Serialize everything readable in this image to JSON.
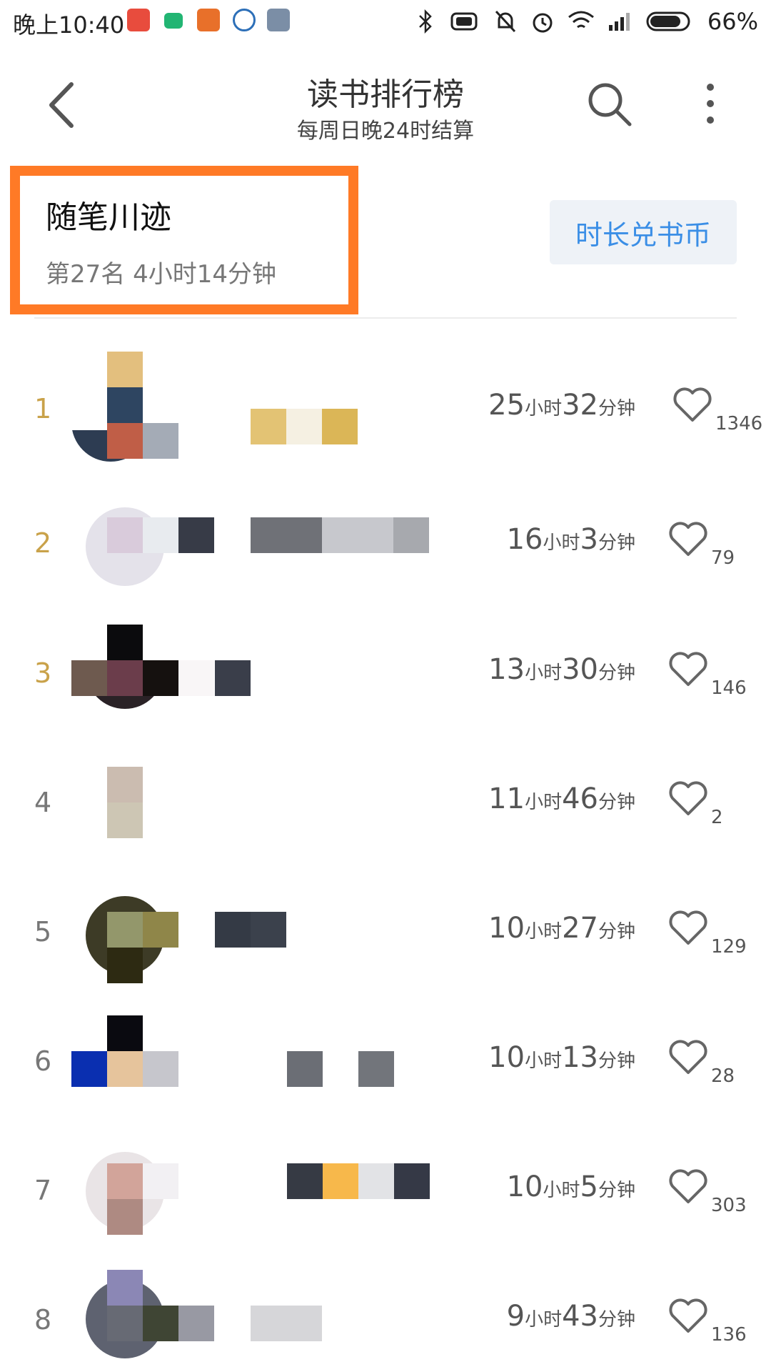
{
  "status_bar": {
    "time": "晚上10:40",
    "battery": "66%"
  },
  "header": {
    "title": "读书排行榜",
    "subtitle": "每周日晚24时结算"
  },
  "my_rank": {
    "name": "随笔川迹",
    "rank_text": "第27名 4小时14分钟"
  },
  "exchange_button": "时长兑书币",
  "units": {
    "hour": "小时",
    "minute": "分钟"
  },
  "rows": [
    {
      "rank": "1",
      "hours": "25",
      "minutes": "32",
      "likes": "1346"
    },
    {
      "rank": "2",
      "hours": "16",
      "minutes": "3",
      "likes": "79"
    },
    {
      "rank": "3",
      "hours": "13",
      "minutes": "30",
      "likes": "146"
    },
    {
      "rank": "4",
      "hours": "11",
      "minutes": "46",
      "likes": "2"
    },
    {
      "rank": "5",
      "hours": "10",
      "minutes": "27",
      "likes": "129"
    },
    {
      "rank": "6",
      "hours": "10",
      "minutes": "13",
      "likes": "28"
    },
    {
      "rank": "7",
      "hours": "10",
      "minutes": "5",
      "likes": "303"
    },
    {
      "rank": "8",
      "hours": "9",
      "minutes": "43",
      "likes": "136"
    }
  ],
  "icons": {
    "back": "chevron-left-icon",
    "search": "search-icon",
    "more": "more-vertical-icon",
    "like": "heart-icon"
  }
}
